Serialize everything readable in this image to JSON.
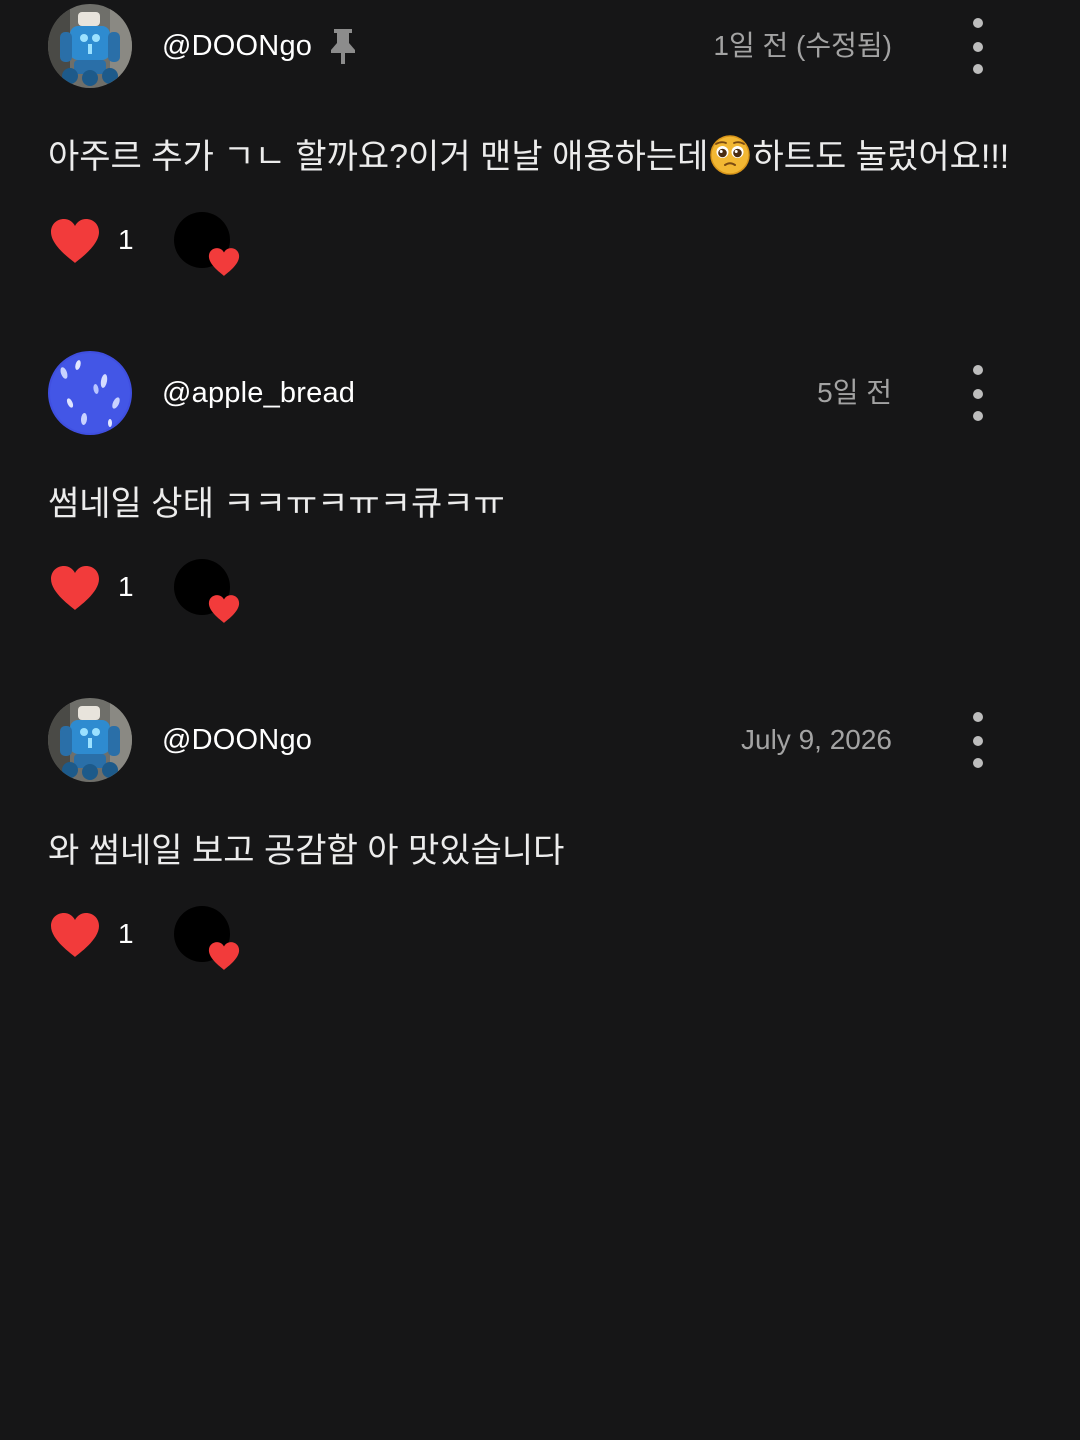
{
  "colors": {
    "background": "#161617",
    "heart": "#f23b3b",
    "text": "#ececec",
    "muted": "#a3a3a3"
  },
  "comments": [
    {
      "username": "@DOONgo",
      "avatar": "robot-avatar",
      "pinned": true,
      "pin_icon": "pin-icon",
      "timestamp": "1일 전 (수정됨)",
      "text_before_emoji": "아주르 추가 ㄱㄴ 할까요?이거 맨날 애용하는데",
      "emoji": "pleading-face-emoji",
      "text_after_emoji": "하트도 눌렀어요!!!",
      "like_count": "1",
      "liked_by_creator": true
    },
    {
      "username": "@apple_bread",
      "avatar": "blue-pattern-avatar",
      "pinned": false,
      "timestamp": "5일 전",
      "text": "썸네일 상태 ㅋㅋㅠㅋㅠㅋ큐ㅋㅠ",
      "like_count": "1",
      "liked_by_creator": true
    },
    {
      "username": "@DOONgo",
      "avatar": "robot-avatar",
      "pinned": false,
      "timestamp": "July 9, 2026",
      "text": "와 썸네일 보고 공감함 아 맛있습니다",
      "like_count": "1",
      "liked_by_creator": true
    }
  ]
}
